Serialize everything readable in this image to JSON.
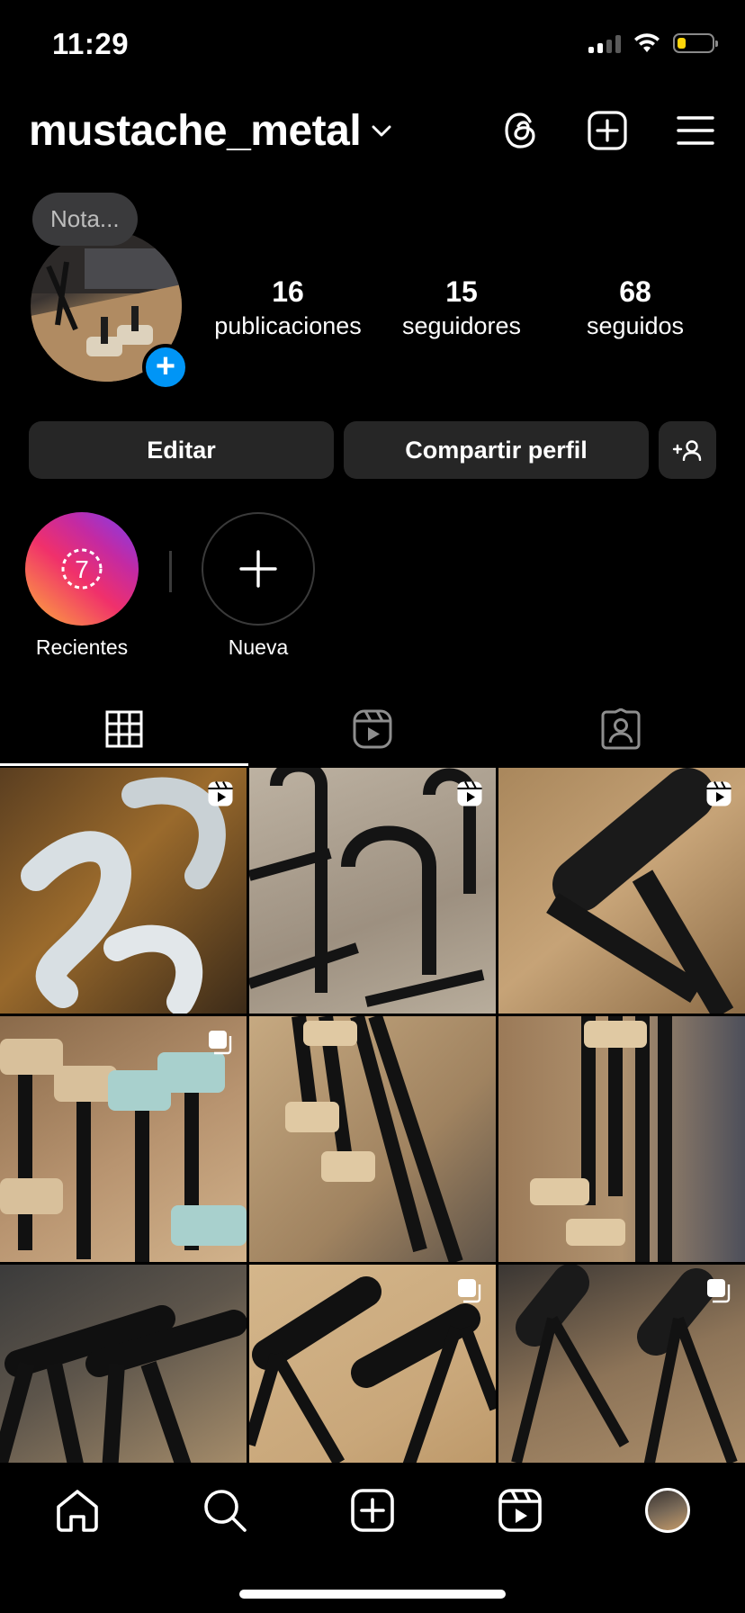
{
  "status_bar": {
    "time": "11:29"
  },
  "header": {
    "username": "mustache_metal"
  },
  "profile": {
    "note": "Nota...",
    "stats": [
      {
        "value": "16",
        "label": "publicaciones"
      },
      {
        "value": "15",
        "label": "seguidores"
      },
      {
        "value": "68",
        "label": "seguidos"
      }
    ]
  },
  "actions": {
    "edit": "Editar",
    "share": "Compartir perfil"
  },
  "highlights": [
    {
      "label": "Recientes",
      "count": "7"
    },
    {
      "label": "Nueva"
    }
  ],
  "tabs": [
    "grid",
    "reels",
    "tagged"
  ],
  "grid": [
    {
      "badge": "reel-icon"
    },
    {
      "badge": "reel-icon"
    },
    {
      "badge": "reel-icon"
    },
    {
      "badge": "carousel-icon"
    },
    {
      "badge": ""
    },
    {
      "badge": ""
    },
    {
      "badge": ""
    },
    {
      "badge": "carousel-icon"
    },
    {
      "badge": "carousel-icon"
    }
  ],
  "colors": {
    "accent": "#0095f6",
    "button_bg": "#262626",
    "background": "#000000"
  }
}
